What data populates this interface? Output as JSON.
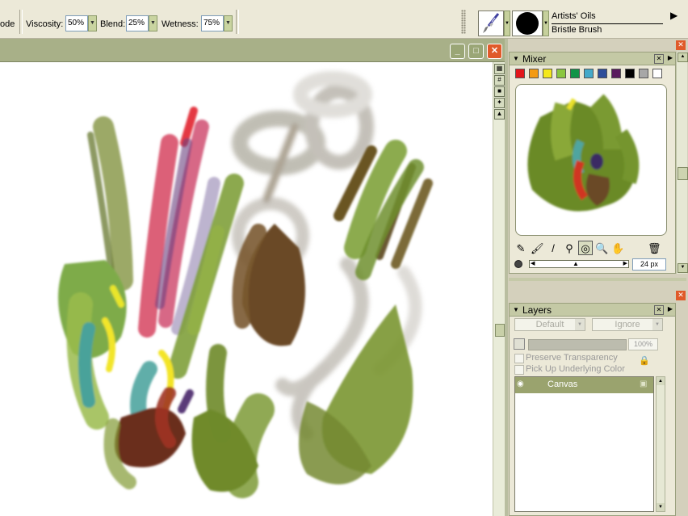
{
  "toolbar": {
    "mode_tail": "ode",
    "viscosity_label": "Viscosity:",
    "viscosity_value": "50%",
    "blend_label": "Blend:",
    "blend_value": "25%",
    "wetness_label": "Wetness:",
    "wetness_value": "75%",
    "brush_category": "Artists' Oils",
    "brush_variant": "Bristle Brush",
    "brush_icon": "paintbrush-icon",
    "dab_icon": "round-dab-icon"
  },
  "document": {
    "minimize_icon": "minimize-icon",
    "maximize_icon": "maximize-icon",
    "close_icon": "close-icon"
  },
  "mixer": {
    "title": "Mixer",
    "swatches": [
      "#e2161b",
      "#f39a12",
      "#f4e81a",
      "#8ac63f",
      "#119447",
      "#44a9c9",
      "#2e4e9a",
      "#5a1b5e",
      "#000000",
      "#a7a7a7",
      "#ffffff"
    ],
    "tools": [
      "dirty-brush-icon",
      "apply-color-icon",
      "mix-color-icon",
      "sample-color-icon",
      "sample-multiple-colors-icon",
      "zoom-icon",
      "pan-icon",
      "clear-pad-icon"
    ],
    "brush_size": "24 px",
    "size_slider_value": 0.45
  },
  "layers": {
    "title": "Layers",
    "composite_method": "Default",
    "composite_depth": "Ignore",
    "opacity": "100%",
    "preserve_transparency": "Preserve Transparency",
    "pick_up_underlying": "Pick Up Underlying Color",
    "items": [
      {
        "name": "Canvas",
        "visible": true,
        "locked": true
      }
    ]
  },
  "colors": {
    "panel_title_bg": "#c4c9a5",
    "doc_title_bg": "#a8b088",
    "selected_layer": "#9aa36e",
    "close_red": "#e05a2a"
  }
}
